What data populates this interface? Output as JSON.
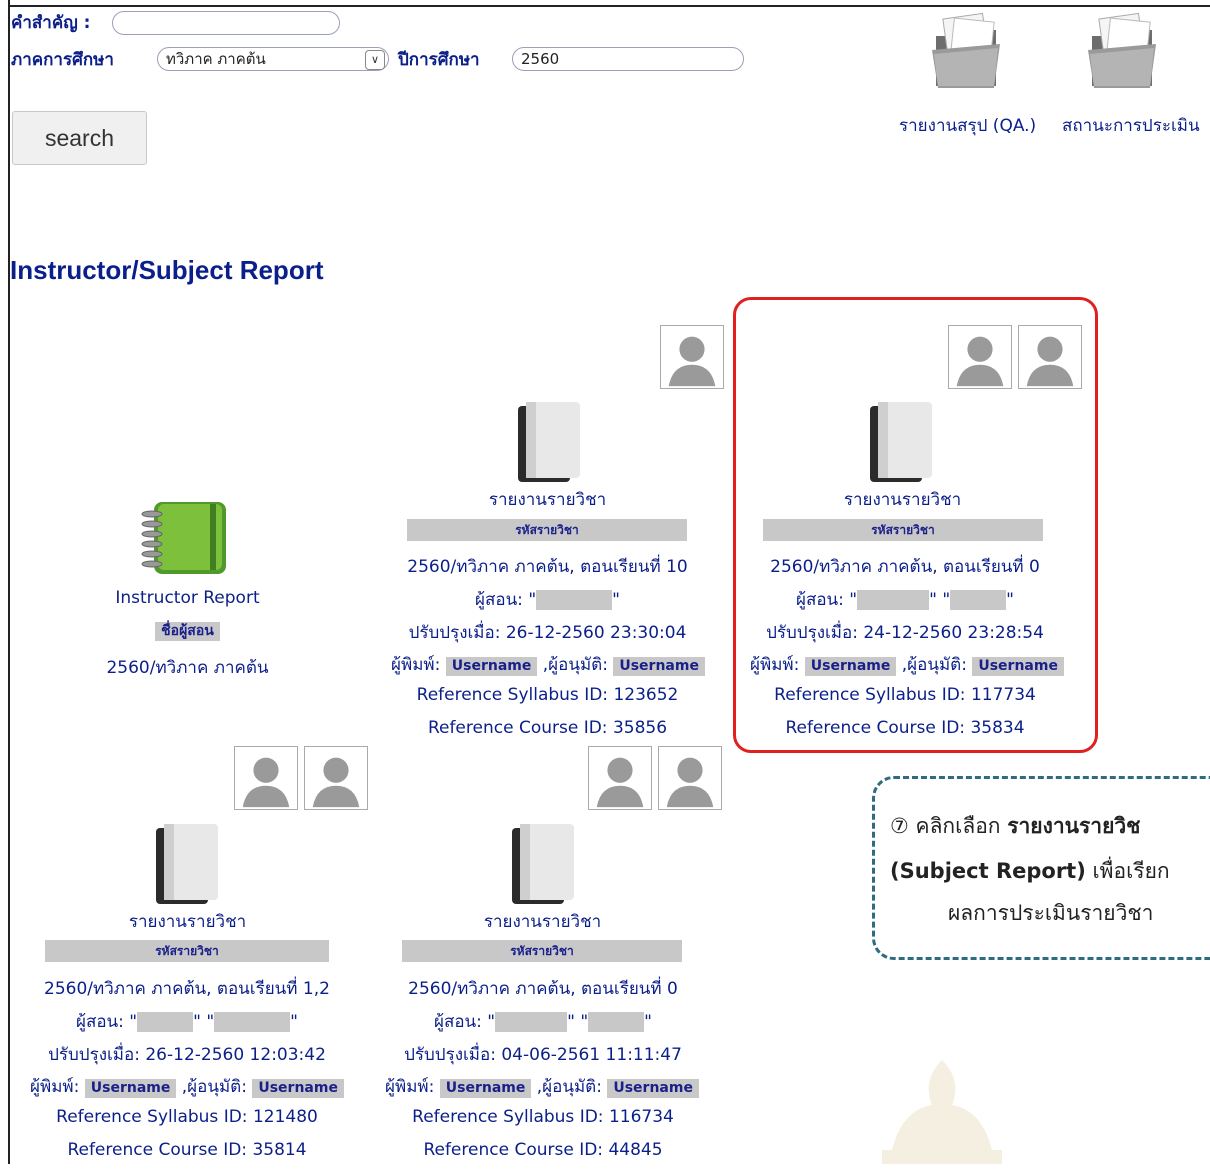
{
  "search_form": {
    "keyword_label": "คำสำคัญ :",
    "keyword_value": "",
    "semester_label": "ภาคการศึกษา",
    "semester_value": "ทวิภาค ภาคต้น",
    "year_label": "ปีการศึกษา",
    "year_value": "2560",
    "search_label": "search"
  },
  "folders": {
    "qa_summary": "รายงานสรุป (QA.)",
    "evaluation_status": "สถานะการประเมิน"
  },
  "heading": "Instructor/Subject Report",
  "instructor_card": {
    "title": "Instructor Report",
    "badge": "ชื่อผู้สอน",
    "term": "2560/ทวิภาค ภาคต้น"
  },
  "common": {
    "report_title": "รายงานรายวิชา",
    "code_badge": "รหัสรายวิชา",
    "instructor_prefix": "ผู้สอน:",
    "updated_prefix": "ปรับปรุงเมื่อ:",
    "typist_prefix": "ผู้พิมพ์:",
    "approver_prefix": ",ผู้อนุมัติ:",
    "username": "Username",
    "syllabus_prefix": "Reference Syllabus ID:",
    "course_prefix": "Reference Course ID:"
  },
  "subjects": [
    {
      "term": "2560/ทวิภาค ภาคต้น, ตอนเรียนที่ 10",
      "updated": "26-12-2560 23:30:04",
      "syllabus_id": "123652",
      "course_id": "35856"
    },
    {
      "term": "2560/ทวิภาค ภาคต้น, ตอนเรียนที่ 0",
      "updated": "24-12-2560 23:28:54",
      "syllabus_id": "117734",
      "course_id": "35834"
    },
    {
      "term": "2560/ทวิภาค ภาคต้น, ตอนเรียนที่ 1,2",
      "updated": "26-12-2560 12:03:42",
      "syllabus_id": "121480",
      "course_id": "35814"
    },
    {
      "term": "2560/ทวิภาค ภาคต้น, ตอนเรียนที่ 0",
      "updated": "04-06-2561 11:11:47",
      "syllabus_id": "116734",
      "course_id": "44845"
    }
  ],
  "callout": {
    "step": "⑦",
    "line1_prefix": "คลิกเลือก",
    "line1_bold": "รายงานรายวิช",
    "line2_bold": "(Subject Report)",
    "line2_rest": "เพื่อเรียก",
    "line3": "ผลการประเมินรายวิชา"
  }
}
